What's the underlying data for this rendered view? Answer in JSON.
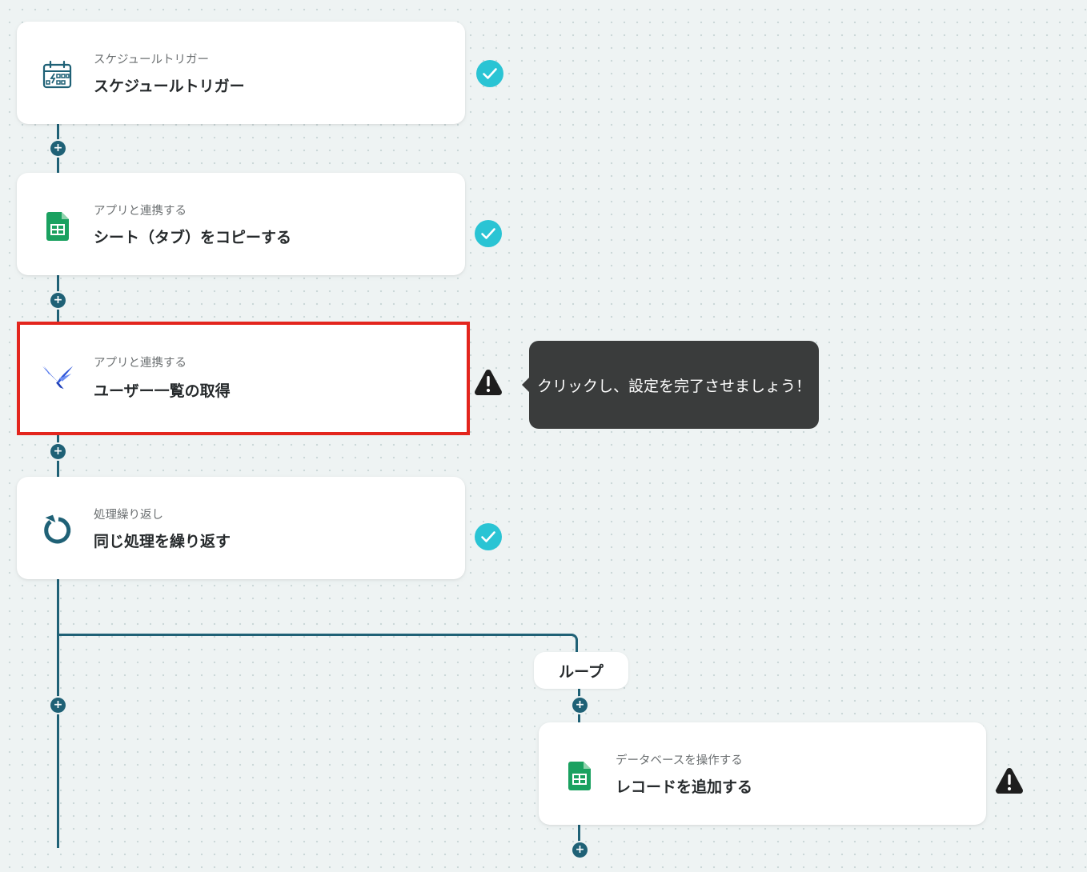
{
  "flow": {
    "steps": [
      {
        "category": "スケジュールトリガー",
        "title": "スケジュールトリガー",
        "icon": "calendar-trigger-icon",
        "status": "complete"
      },
      {
        "category": "アプリと連携する",
        "title": "シート（タブ）をコピーする",
        "icon": "google-sheets-icon",
        "status": "complete"
      },
      {
        "category": "アプリと連携する",
        "title": "ユーザー一覧の取得",
        "icon": "bird-app-icon",
        "status": "warning",
        "highlighted": true
      },
      {
        "category": "処理繰り返し",
        "title": "同じ処理を繰り返す",
        "icon": "loop-icon",
        "status": "complete"
      }
    ],
    "loop": {
      "label": "ループ",
      "steps": [
        {
          "category": "データベースを操作する",
          "title": "レコードを追加する",
          "icon": "google-sheets-icon",
          "status": "warning"
        }
      ]
    },
    "tooltip": "クリックし、設定を完了させましょう！",
    "add_symbol": "+",
    "colors": {
      "connector": "#1f6176",
      "check": "#2ac4d4",
      "highlight": "#e3251d",
      "warning": "#1e1e1e",
      "tooltip_bg": "#3a3c3c"
    }
  }
}
